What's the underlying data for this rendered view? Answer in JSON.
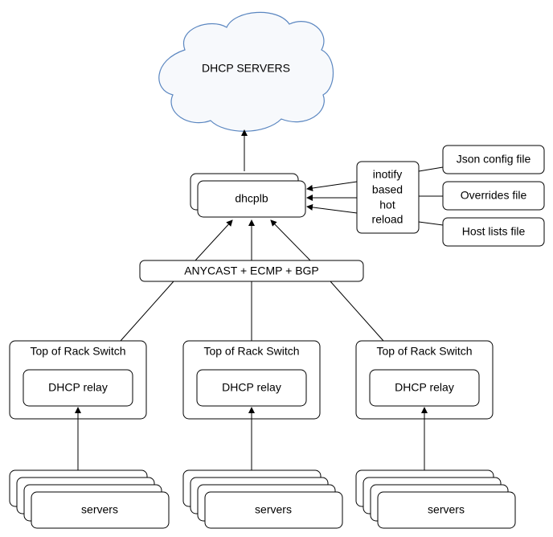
{
  "cloud": {
    "label": "DHCP SERVERS",
    "fill": "#f7f9fc",
    "stroke": "#5a86c0"
  },
  "dhcplb": {
    "label": "dhcplb"
  },
  "reload": {
    "lines": [
      "inotify",
      "based",
      "hot",
      "reload"
    ]
  },
  "files": [
    "Json config file",
    "Overrides file",
    "Host lists file"
  ],
  "anycast": {
    "label": "ANYCAST + ECMP + BGP"
  },
  "racks": [
    {
      "switch": "Top of Rack Switch",
      "relay": "DHCP relay",
      "servers": "servers"
    },
    {
      "switch": "Top of Rack Switch",
      "relay": "DHCP relay",
      "servers": "servers"
    },
    {
      "switch": "Top of Rack Switch",
      "relay": "DHCP relay",
      "servers": "servers"
    }
  ]
}
